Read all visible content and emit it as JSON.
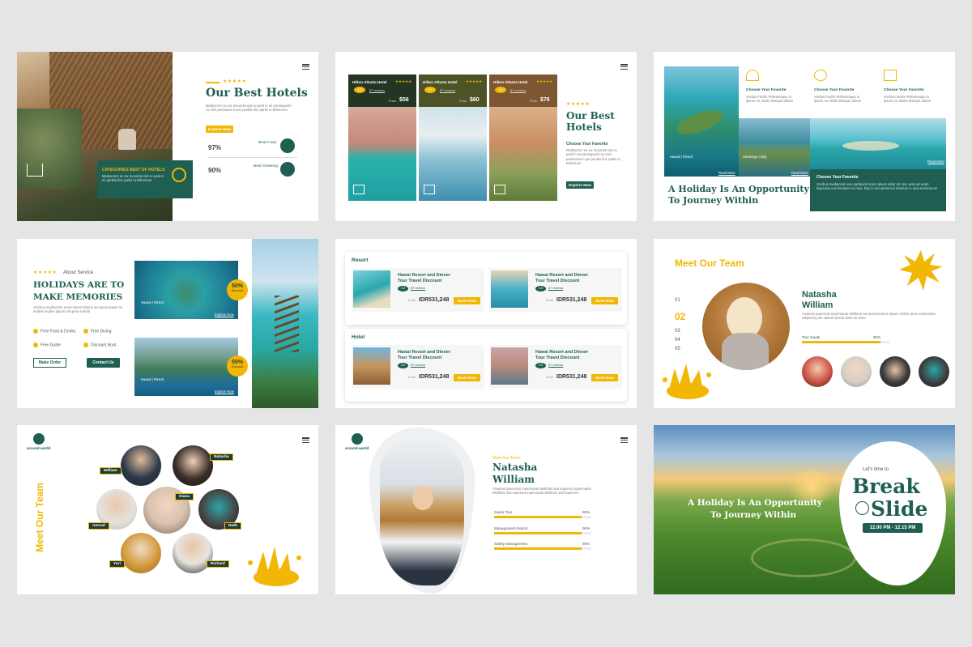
{
  "slide1": {
    "stars": "★★★★★",
    "title": "Our Best Hotels",
    "body": "Mediocrem ex vix mouretis nisl ex perit in ne persequeris ex mini pertinacia in per jambis fine partis to Ethereum",
    "button": "Explore Now",
    "stat1_value": "97%",
    "stat1_label": "Best Food",
    "stat2_value": "90%",
    "stat2_label": "Best Cleaning",
    "categories_title": "CATEGORIES BEST OF HOTELS",
    "categories_body": "Mediocrem ex vix mouretis nisl ex perit in ne jambis fine partis to Ethereum"
  },
  "slide2": {
    "cards": [
      {
        "name": "Hilton Atlanta Hotel",
        "stars": "★★★★★",
        "rating": "4.5",
        "reviews": "87 reviews",
        "from": "From",
        "price": "$56"
      },
      {
        "name": "Hilton Atlanta Hotel",
        "stars": "★★★★★",
        "rating": "4.5",
        "reviews": "87 reviews",
        "from": "From",
        "price": "$60"
      },
      {
        "name": "Hilton Atlanta Hotel",
        "stars": "★★★★★",
        "rating": "4.5",
        "reviews": "87 reviews",
        "from": "From",
        "price": "$76"
      }
    ],
    "stars": "★★★★★",
    "title": "Our Best Hotels",
    "subtitle": "Choose Your Favorite",
    "body": "Mediocrem ex vix mouretis nisl ex perit in ne persequeris ex mini pertinacia in per jambis fine partis to Ethereum",
    "button": "Explore Now"
  },
  "slide3": {
    "features": [
      {
        "title": "Choose Your Favorite",
        "body": "Voclius Facilis Pellentesque in ipsum mi. Morbi tristique dolore"
      },
      {
        "title": "Choose Your Favorite",
        "body": "Voclius Facilis Pellentesque in ipsum mi. Morbi tristique dolore"
      },
      {
        "title": "Choose Your Favorite",
        "body": "Voclius Facilis Pellentesque in ipsum mi. Morbi tristique dolore"
      }
    ],
    "place1": "Hawaii | Resort",
    "place2": "SanDiego | Italy",
    "read_more": "Read More",
    "title_line1": "A Holiday Is An Opportunity",
    "title_line2": "To Journey Within",
    "box_title": "Choose Your Favorite",
    "box_body": "Vocibus mediocrem eos partiendo lorem ipsum dolor sit. Nec ante an erant legendos eos insolens ex mea. Duo in mei persecuti dolorum in mea nemmerum"
  },
  "slide4": {
    "stars": "★★★★★",
    "about": "About Service",
    "title_line1": "HOLIDAYS ARE TO",
    "title_line2": "MAKE MEMORIES",
    "body": "Vocibus mediocrem eovis lorenz Mouris sed peria ipsum mi sedent erudire ipsum ntis pera sedent",
    "checks": [
      "Free Food & Drinks",
      "Free Diving",
      "Free Guide",
      "Discount Boat"
    ],
    "btn1": "Make Order",
    "btn2": "Contact Us",
    "badge1_value": "50%",
    "badge1_label": "Discount",
    "badge2_value": "55%",
    "badge2_label": "Discount",
    "place1": "Hawaii | Resort",
    "place2": "Hawaii | Resort",
    "explore": "Explore Now"
  },
  "slide5": {
    "section1": "Resort",
    "section2": "Hotel",
    "items": [
      {
        "title1": "Hawai Resort and Dinner",
        "title2": "Tour Travel Discount",
        "rating": "4.5",
        "reviews": "87 reviews",
        "from": "From",
        "price": "IDR531,248",
        "button": "Book Now"
      },
      {
        "title1": "Hawai Resort and Dinner",
        "title2": "Tour Travel Discount",
        "rating": "4.5",
        "reviews": "87 reviews",
        "from": "From",
        "price": "IDR531,248",
        "button": "Book Now"
      },
      {
        "title1": "Hawai Resort and Dinner",
        "title2": "Tour Travel Discount",
        "rating": "4.5",
        "reviews": "87 reviews",
        "from": "From",
        "price": "IDR531,248",
        "button": "Book Now"
      },
      {
        "title1": "Hawai Resort and Dinner",
        "title2": "Tour Travel Discount",
        "rating": "4.5",
        "reviews": "87 reviews",
        "from": "From",
        "price": "IDR531,248",
        "button": "Book Now"
      }
    ]
  },
  "slide6": {
    "title": "Meet Our Team",
    "numbers": [
      "01",
      "02",
      "03",
      "04",
      "05"
    ],
    "name_line1": "Natasha",
    "name_line2": "William",
    "body": "Vivamus quererum inpermante Meliforis eat summa lorem ipsum dolore pera consectetur adipiscing elit. Mauris ipsum dolor sit amet",
    "skill": "Tour Guide",
    "skill_pct": "90%",
    "skill_value": 0.9
  },
  "slide7": {
    "logo": "around-world",
    "title": "Meet Our Team",
    "names": [
      "William",
      "Natasha",
      "Diana",
      "Gerrad",
      "Ruth",
      "Yuri",
      "Richard"
    ]
  },
  "slide8": {
    "logo": "around-world",
    "kicker": "Meet Our Team",
    "name_line1": "Natasha",
    "name_line2": "William",
    "body": "Vivamus quererum Inpermante Meliforis sed superera inpermante Meliforis sed superera inpermante Meliforis sed superera",
    "skills": [
      {
        "label": "Guide Tour",
        "pct": "90%",
        "value": 0.9
      },
      {
        "label": "Management Resort",
        "pct": "90%",
        "value": 0.9
      },
      {
        "label": "Safety Management",
        "pct": "90%",
        "value": 0.9
      }
    ]
  },
  "slide9": {
    "title_line1": "A Holiday Is An Opportunity",
    "title_line2": "To Journey Within",
    "kicker": "Let's time to",
    "break1": "Break",
    "break2": "Slide",
    "time": "12.00 PM - 12.15 PM"
  }
}
